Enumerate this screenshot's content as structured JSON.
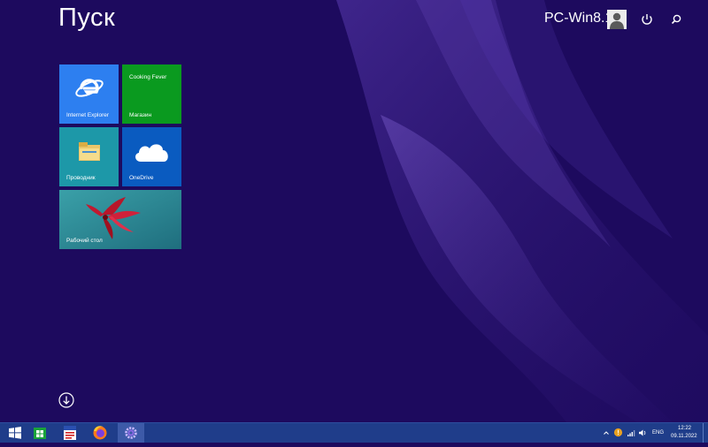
{
  "start": {
    "title": "Пуск"
  },
  "user": {
    "name": "PC-Win8.1"
  },
  "header_icons": {
    "power": "power-icon",
    "search": "search-icon",
    "avatar": "user-avatar-icon"
  },
  "tiles": [
    {
      "label": "Internet Explorer",
      "color": "#2d7ff0",
      "icon": "internet-explorer-icon"
    },
    {
      "top_label": "Cooking Fever",
      "label": "Магазин",
      "color": "#0a9a1f"
    },
    {
      "label": "Проводник",
      "color": "#1d98a8",
      "icon": "folder-icon"
    },
    {
      "label": "OneDrive",
      "color": "#0a5bc0",
      "icon": "cloud-icon"
    },
    {
      "label": "Рабочий стол",
      "color": "#2e8a9a",
      "icon": "desktop-wallpaper-flower"
    }
  ],
  "apps_button": {
    "icon": "arrow-down-circle-icon"
  },
  "taskbar": {
    "color": "#1f3d8a",
    "items": [
      {
        "icon": "windows-logo-icon"
      },
      {
        "icon": "store-icon"
      },
      {
        "icon": "document-app-icon"
      },
      {
        "icon": "firefox-icon"
      },
      {
        "icon": "settings-gear-icon"
      }
    ],
    "tray": {
      "language": "ENG",
      "time": "12:22",
      "date": "09.11.2022"
    }
  },
  "colors": {
    "background": "#1d0a5e",
    "accent": "#3d5aa8"
  }
}
